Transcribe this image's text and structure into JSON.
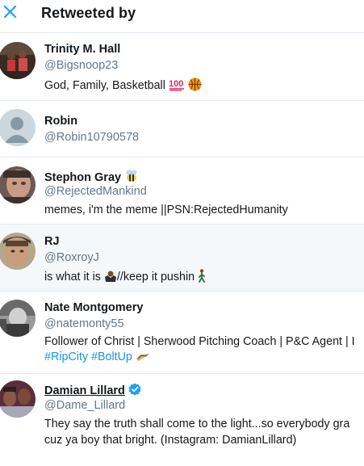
{
  "header": {
    "title": "Retweeted by"
  },
  "users": [
    {
      "name": "Trinity M. Hall",
      "handle": "@Bigsnoop23",
      "bio": "God, Family, Basketball"
    },
    {
      "name": "Robin",
      "handle": "@Robin10790578"
    },
    {
      "name": "Stephon Gray",
      "handle": "@RejectedMankind",
      "bio": "memes, i'm the meme ||PSN:RejectedHumanity"
    },
    {
      "name": "RJ",
      "handle": "@RoxroyJ",
      "bio_a": "is what it is",
      "bio_b": "//keep it pushin"
    },
    {
      "name": "Nate Montgomery",
      "handle": "@natemonty55",
      "bio": "Follower of Christ | Sherwood Pitching Coach | P&C Agent | I",
      "tags": [
        "#RipCity",
        "#BoltUp"
      ]
    },
    {
      "name": "Damian Lillard",
      "handle": "@Dame_Lillard",
      "bio_line1": "They say the truth shall come to the light...so everybody gra",
      "bio_line2": "cuz ya boy that bright. (Instagram: DamianLillard)"
    }
  ],
  "colors": {
    "accent": "#1da1f2",
    "link": "#1b95e0",
    "secondary_text": "#657786",
    "divider": "#e6ecf0"
  }
}
